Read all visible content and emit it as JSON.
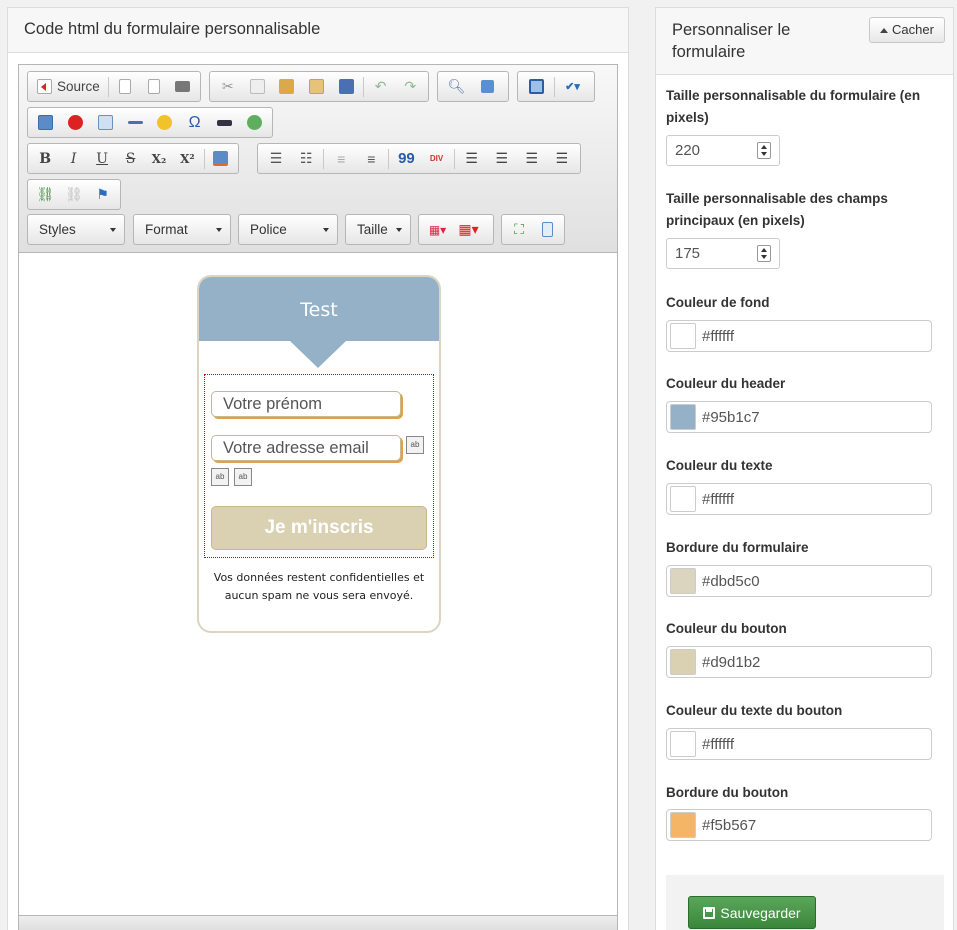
{
  "left_panel": {
    "title": "Code html du formulaire personnalisable"
  },
  "toolbar": {
    "source_label": "Source",
    "styles_label": "Styles",
    "format_label": "Format",
    "font_label": "Police",
    "size_label": "Taille",
    "bold": "B",
    "italic": "I",
    "underline": "U",
    "strike": "S",
    "subscript": "X₂",
    "superscript": "X²",
    "blockquote": "99",
    "div_container": "DIV",
    "omega": "Ω"
  },
  "preview": {
    "header_text": "Test",
    "firstname_placeholder": "Votre prénom",
    "email_placeholder": "Votre adresse email",
    "submit_label": "Je m'inscris",
    "note": "Vos données restent confidentielles et aucun spam ne vous sera envoyé.",
    "hidden_field_icon": "ab"
  },
  "right_panel": {
    "title": "Personnaliser le formulaire",
    "hide_label": "Cacher",
    "form_width_label": "Taille personnalisable du formulaire (en pixels)",
    "form_width_value": "220",
    "fields_width_label": "Taille personnalisable des champs principaux (en pixels)",
    "fields_width_value": "175",
    "colors": [
      {
        "label": "Couleur de fond",
        "value": "#ffffff",
        "hex": "#ffffff"
      },
      {
        "label": "Couleur du header",
        "value": "#95b1c7",
        "hex": "#95b1c7"
      },
      {
        "label": "Couleur du texte",
        "value": "#ffffff",
        "hex": "#ffffff"
      },
      {
        "label": "Bordure du formulaire",
        "value": "#dbd5c0",
        "hex": "#dbd5c0"
      },
      {
        "label": "Couleur du bouton",
        "value": "#d9d1b2",
        "hex": "#d9d1b2"
      },
      {
        "label": "Couleur du texte du bouton",
        "value": "#ffffff",
        "hex": "#ffffff"
      },
      {
        "label": "Bordure du bouton",
        "value": "#f5b567",
        "hex": "#f5b567"
      }
    ],
    "save_label": "Sauvegarder"
  },
  "colors": {
    "save_button": "#3d8b3d",
    "header": "#95b1c7",
    "form_border": "#dbd5c0"
  }
}
